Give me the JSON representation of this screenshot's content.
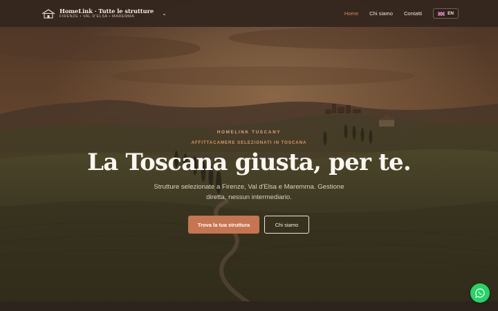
{
  "brand": {
    "title": "HomeLink · Tutte le strutture",
    "subtitle": "FIRENZE • VAL D'ELSA • MAREMMA",
    "logo_icon": "house-logo-icon",
    "chevron_icon": "chevron-down-icon"
  },
  "nav": {
    "items": [
      {
        "label": "Home",
        "active": true
      },
      {
        "label": "Chi siamo",
        "active": false
      },
      {
        "label": "Contatti",
        "active": false
      }
    ],
    "language": {
      "label": "EN",
      "flag_icon": "uk-flag-icon"
    }
  },
  "hero": {
    "eyebrow": "HOMELINK TUSCANY",
    "eyebrow2": "AFFITTACAMERE SELEZIONATI IN TOSCANA",
    "headline": "La Toscana giusta, per te.",
    "subtext": "Strutture selezionate a Firenze, Val d'Elsa e Maremma. Gestione diretta, nessun intermediario.",
    "primary_cta": "Trova la tua struttura",
    "secondary_cta": "Chi siamo"
  },
  "fab": {
    "icon": "whatsapp-icon"
  },
  "colors": {
    "accent": "#c57650",
    "nav_active": "#d58a63",
    "eyebrow": "#e0a47c",
    "navbar_bg": "#34261e",
    "whatsapp": "#25d366"
  }
}
